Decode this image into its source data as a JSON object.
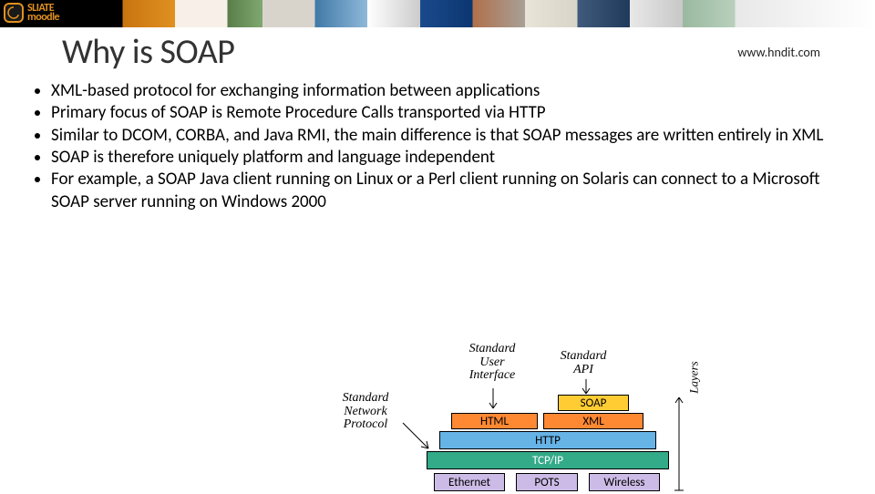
{
  "header": {
    "brand_top": "SLIATE",
    "brand_bottom": "moodle"
  },
  "title": "Why is SOAP",
  "url": "www.hndit.com",
  "bullets": [
    "XML-based protocol for exchanging information between applications",
    "Primary focus of SOAP is Remote Procedure Calls transported via HTTP",
    "Similar to DCOM, CORBA, and Java RMI, the main difference is that SOAP messages are written entirely in XML",
    "SOAP is therefore uniquely platform and language independent",
    "For example, a SOAP Java client running on Linux or a Perl client running on Solaris can connect to a Microsoft SOAP server running on Windows 2000"
  ],
  "diagram": {
    "labels": {
      "std_net": "Standard\nNetwork\nProtocol",
      "std_ui": "Standard\nUser\nInterface",
      "std_api": "Standard\nAPI",
      "layers": "Layers"
    },
    "boxes": {
      "soap": "SOAP",
      "html": "HTML",
      "xml": "XML",
      "http": "HTTP",
      "tcp": "TCP/IP",
      "ethernet": "Ethernet",
      "pots": "POTS",
      "wireless": "Wireless"
    }
  }
}
